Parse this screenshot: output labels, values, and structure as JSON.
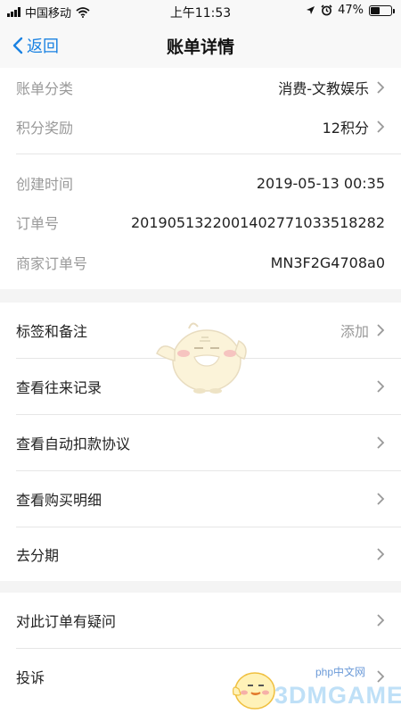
{
  "status_bar": {
    "carrier": "中国移动",
    "time": "上午11:53",
    "battery": "47%",
    "battery_level": 0.47
  },
  "nav": {
    "back_label": "返回",
    "title": "账单详情"
  },
  "group1": [
    {
      "label": "账单分类",
      "value": "消费-文教娱乐"
    },
    {
      "label": "积分奖励",
      "value": "12积分"
    }
  ],
  "group2": [
    {
      "label": "创建时间",
      "value": "2019-05-13 00:35"
    },
    {
      "label": "订单号",
      "value": "2019051322001402771033518282"
    },
    {
      "label": "商家订单号",
      "value": "MN3F2G4708a0"
    }
  ],
  "group3": [
    {
      "label": "标签和备注",
      "value": "添加"
    },
    {
      "label": "查看往来记录"
    },
    {
      "label": "查看自动扣款协议"
    },
    {
      "label": "查看购买明细"
    },
    {
      "label": "去分期"
    }
  ],
  "group4": [
    {
      "label": "对此订单有疑问"
    },
    {
      "label": "投诉"
    }
  ],
  "watermark": {
    "brand": "3DMGAME",
    "site_small": "php中文网"
  },
  "icons": {
    "back": "chevron-left-icon",
    "row_arrow": "chevron-right-icon",
    "wifi": "wifi-icon",
    "location": "location-icon",
    "alarm": "alarm-icon"
  },
  "colors": {
    "accent": "#1a82e2",
    "label_gray": "#999999",
    "background": "#f4f4f4"
  }
}
